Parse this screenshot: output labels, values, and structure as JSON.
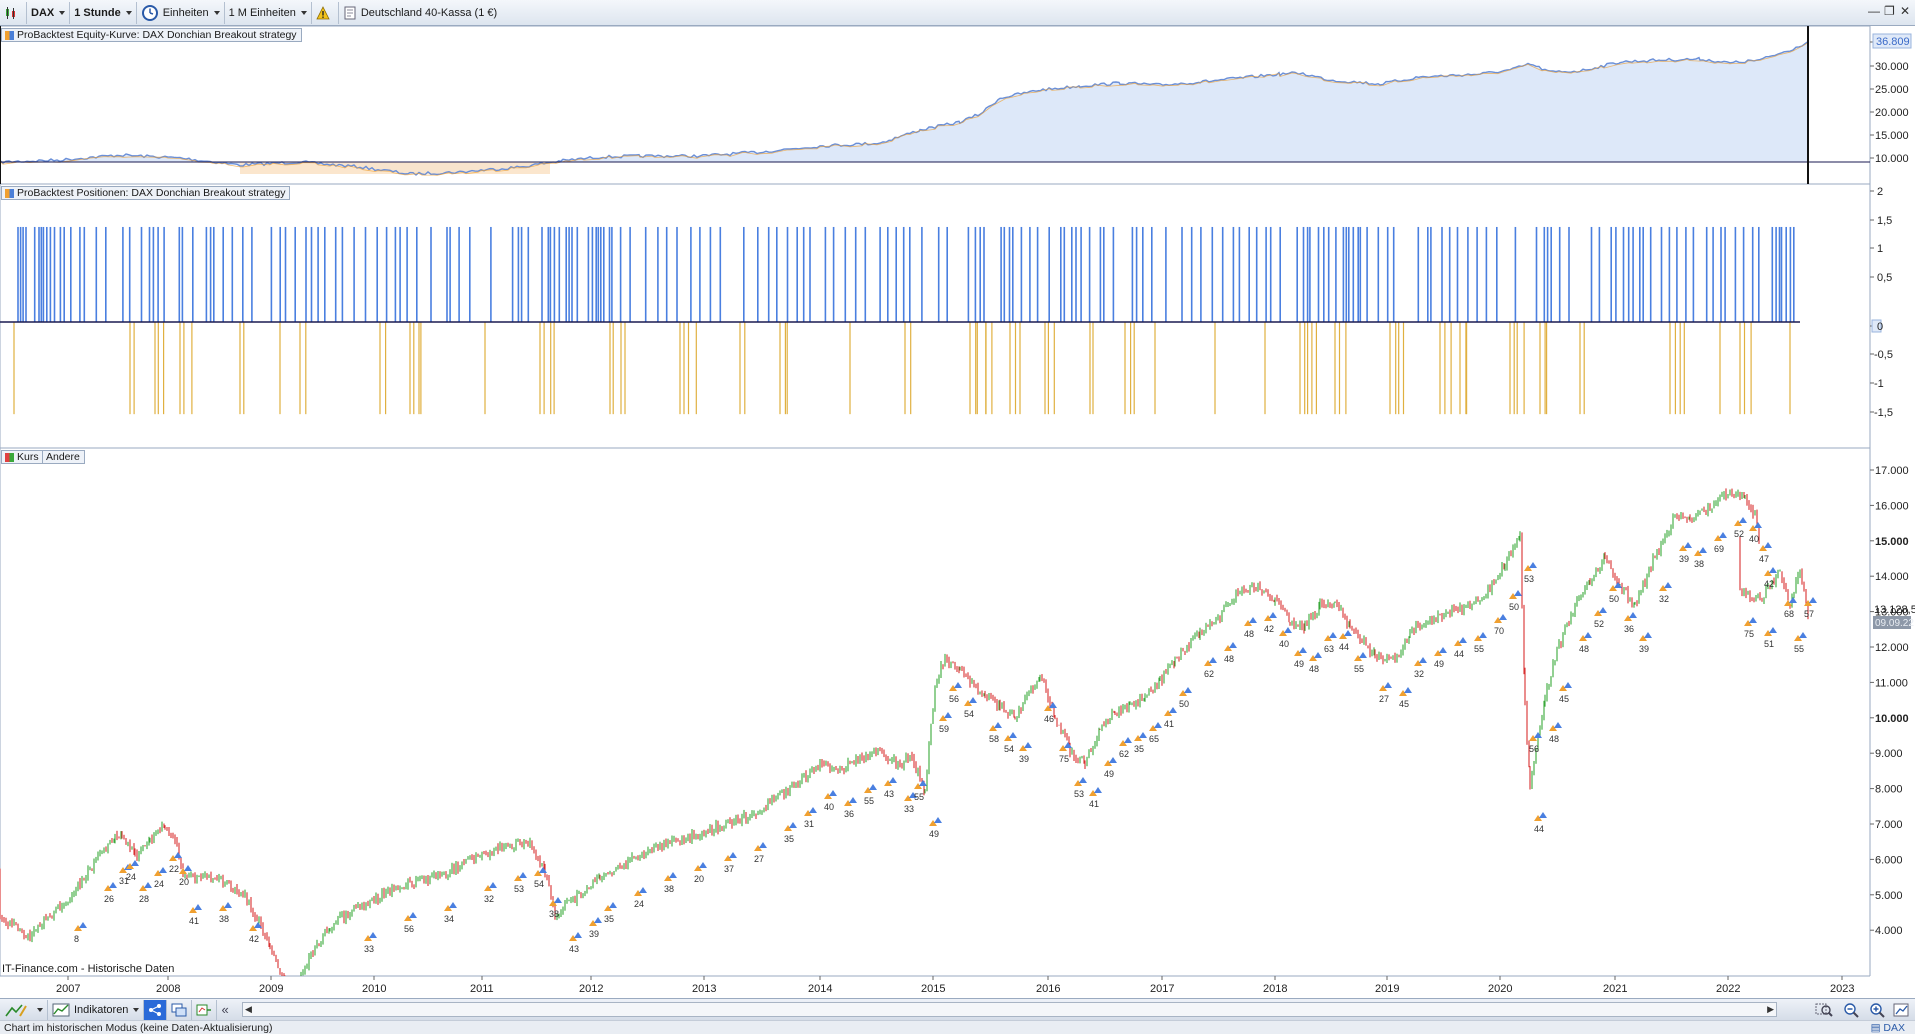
{
  "toolbar": {
    "instrument": "DAX",
    "timeframe": "1 Stunde",
    "units_label": "Einheiten",
    "units_count": "1 M Einheiten",
    "instrument_title": "Deutschland 40-Kassa (1 €)"
  },
  "panels": {
    "equity": {
      "tag": "ProBacktest Equity-Kurve: DAX Donchian Breakout strategy",
      "current_value": "36.809",
      "y_ticks": [
        "35.000",
        "30.000",
        "25.000",
        "20.000",
        "15.000",
        "10.000"
      ],
      "colors": {
        "fill": "#dde8f9",
        "line": "#6a8fd8",
        "drawdown_fill": "#fbe3c8",
        "line_alt": "#f0a030"
      }
    },
    "positions": {
      "tag": "ProBacktest Positionen: DAX Donchian Breakout strategy",
      "y_ticks": [
        "2",
        "1,5",
        "1",
        "0,5",
        "0",
        "-0,5",
        "-1",
        "-1,5"
      ],
      "colors": {
        "long": "#4a7fe0",
        "short": "#e0b040"
      }
    },
    "price": {
      "tag": "Kurs",
      "tag_other": "Andere",
      "y_ticks": [
        "17.000",
        "16.000",
        "15.000",
        "14.000",
        "13.000",
        "12.000",
        "11.000",
        "10.000",
        "9.000",
        "8.000",
        "7.000",
        "6.000",
        "5.000",
        "4.000"
      ],
      "current_price": "13.128,5",
      "current_date": "09.09.22",
      "source": "IT-Finance.com - Historische Daten",
      "colors": {
        "up": "#3aa83a",
        "down": "#d83030",
        "buy_arrow": "#4a7fe0",
        "sell_arrow": "#f0a030"
      }
    }
  },
  "x_axis": {
    "years": [
      "2007",
      "2008",
      "2009",
      "2010",
      "2011",
      "2012",
      "2013",
      "2014",
      "2015",
      "2016",
      "2017",
      "2018",
      "2019",
      "2020",
      "2021",
      "2022",
      "2023"
    ]
  },
  "bottom_bar": {
    "indicators_label": "Indikatoren"
  },
  "status": {
    "text": "Chart im historischen Modus (keine Daten-Aktualisierung)",
    "instrument": "DAX"
  }
}
